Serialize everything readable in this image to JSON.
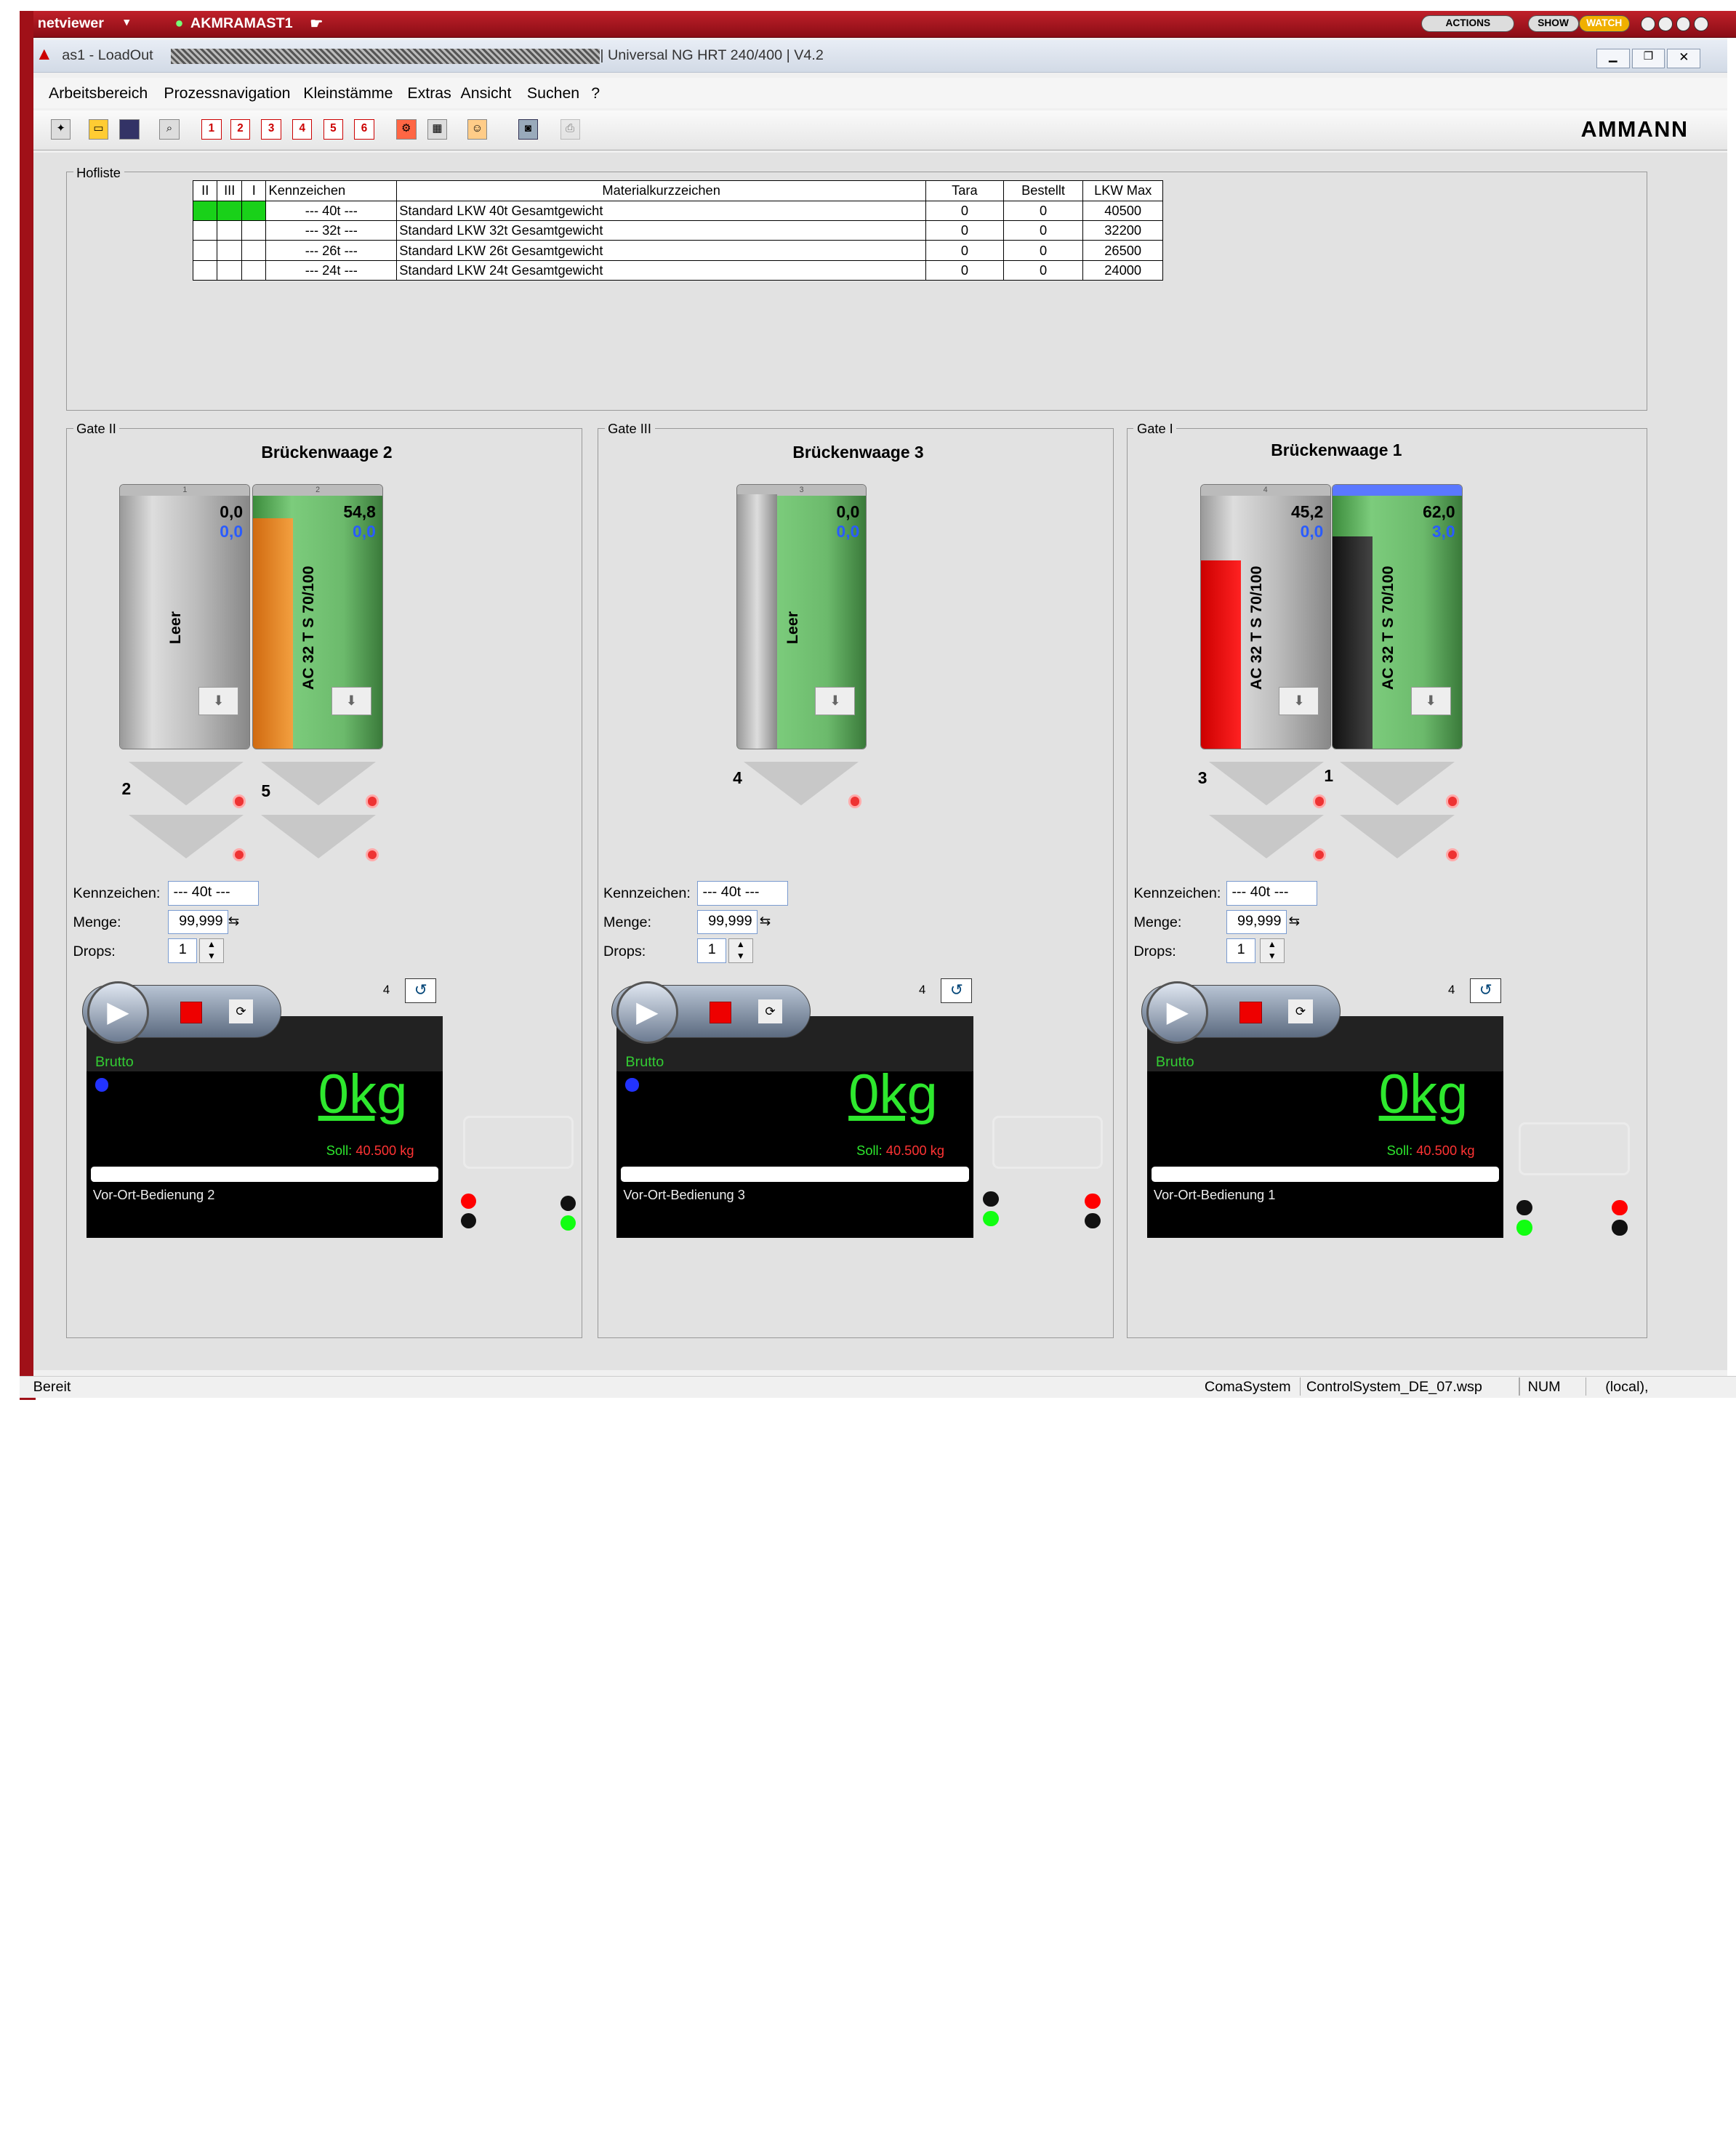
{
  "viewer": {
    "brand": "netviewer",
    "host": "AKMRAMAST1",
    "actions": "ACTIONS",
    "show": "SHOW",
    "watch": "WATCH"
  },
  "window": {
    "title_app": "as1 - LoadOut",
    "title_info": "| Universal NG HRT 240/400 | V4.2",
    "logo": "AMMANN"
  },
  "menu": [
    "Arbeitsbereich",
    "Prozessnavigation",
    "Kleinstämme",
    "Extras",
    "Ansicht",
    "Suchen",
    "?"
  ],
  "toolbar": {
    "numbers": [
      "1",
      "2",
      "3",
      "4",
      "5",
      "6"
    ]
  },
  "hofliste": {
    "label": "Hofliste",
    "headers": [
      "II",
      "III",
      "I",
      "Kennzeichen",
      "Materialkurzzeichen",
      "Tara",
      "Bestellt",
      "LKW Max"
    ],
    "rows": [
      {
        "kz": "--- 40t ---",
        "mat": "Standard LKW 40t Gesamtgewicht",
        "tara": "0",
        "bestellt": "0",
        "max": "40500"
      },
      {
        "kz": "--- 32t ---",
        "mat": "Standard LKW 32t Gesamtgewicht",
        "tara": "0",
        "bestellt": "0",
        "max": "32200"
      },
      {
        "kz": "--- 26t ---",
        "mat": "Standard LKW 26t Gesamtgewicht",
        "tara": "0",
        "bestellt": "0",
        "max": "26500"
      },
      {
        "kz": "--- 24t ---",
        "mat": "Standard LKW 24t Gesamtgewicht",
        "tara": "0",
        "bestellt": "0",
        "max": "24000"
      }
    ]
  },
  "labels": {
    "kennzeichen": "Kennzeichen:",
    "menge": "Menge:",
    "drops": "Drops:",
    "brutto": "Brutto",
    "soll": "Soll:"
  },
  "gates": [
    {
      "label": "Gate II",
      "title": "Brückenwaage 2",
      "kz": "--- 40t ---",
      "menge": "99,999",
      "drops": "1",
      "count": "4",
      "weight": "0kg",
      "soll": "40.500 kg",
      "vor": "Vor-Ort-Bedienung 2",
      "silos": [
        {
          "hdr": "1",
          "v1": "0,0",
          "v2": "0,0",
          "text": "Leer",
          "num": "2"
        },
        {
          "hdr": "2",
          "v1": "54,8",
          "v2": "0,0",
          "text": "AC 32 T S 70/100",
          "num": "5"
        }
      ]
    },
    {
      "label": "Gate III",
      "title": "Brückenwaage 3",
      "kz": "--- 40t ---",
      "menge": "99,999",
      "drops": "1",
      "count": "4",
      "weight": "0kg",
      "soll": "40.500 kg",
      "vor": "Vor-Ort-Bedienung 3",
      "silos": [
        {
          "hdr": "3",
          "v1": "0,0",
          "v2": "0,0",
          "text": "Leer",
          "num": "4"
        }
      ]
    },
    {
      "label": "Gate I",
      "title": "Brückenwaage 1",
      "kz": "--- 40t ---",
      "menge": "99,999",
      "drops": "1",
      "count": "4",
      "weight": "0kg",
      "soll": "40.500 kg",
      "vor": "Vor-Ort-Bedienung 1",
      "silos": [
        {
          "hdr": "4",
          "v1": "45,2",
          "v2": "0,0",
          "text": "AC 32 T S 70/100",
          "num": "3"
        },
        {
          "hdr": "5",
          "v1": "62,0",
          "v2": "3,0",
          "text": "AC 32 T S 70/100",
          "num": "1"
        }
      ]
    }
  ],
  "status": {
    "left": "Bereit",
    "system": "ComaSystem",
    "file": "ControlSystem_DE_07.wsp",
    "num": "NUM",
    "local": "(local),"
  }
}
